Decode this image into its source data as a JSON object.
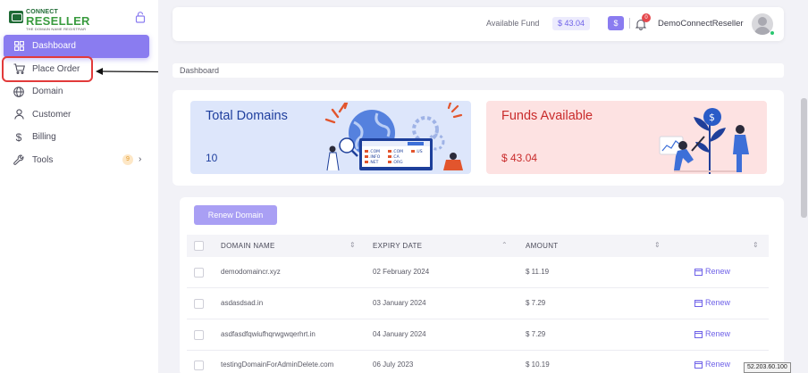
{
  "logo": {
    "top": "CONNECT",
    "main": "RESELLER",
    "tagline": "THE DOMAIN NAME REGISTRAR"
  },
  "sidebar": {
    "items": [
      {
        "label": "Dashboard",
        "icon": "grid-icon",
        "active": true
      },
      {
        "label": "Place Order",
        "icon": "cart-icon",
        "highlighted": true
      },
      {
        "label": "Domain",
        "icon": "globe-icon"
      },
      {
        "label": "Customer",
        "icon": "user-icon"
      },
      {
        "label": "Billing",
        "icon": "dollar-icon"
      },
      {
        "label": "Tools",
        "icon": "wrench-icon",
        "badge": "9"
      }
    ]
  },
  "header": {
    "fund_label": "Available Fund",
    "fund_value": "$ 43.04",
    "dollar_button": "$",
    "notification_count": "0",
    "username": "DemoConnectReseller"
  },
  "breadcrumb": "Dashboard",
  "stats": {
    "domains": {
      "title": "Total Domains",
      "value": "10",
      "tlds": [
        ".COM",
        ".COM",
        ".US",
        ".INFO",
        ".CA",
        ".NET",
        ".ORG"
      ]
    },
    "funds": {
      "title": "Funds Available",
      "value": "$ 43.04"
    }
  },
  "table": {
    "renew_button": "Renew Domain",
    "columns": [
      "DOMAIN NAME",
      "EXPIRY DATE",
      "AMOUNT"
    ],
    "rows": [
      {
        "domain": "demodomaincr.xyz",
        "expiry": "02 February 2024",
        "amount": "$ 11.19",
        "action": "Renew"
      },
      {
        "domain": "asdasdsad.in",
        "expiry": "03 January 2024",
        "amount": "$ 7.29",
        "action": "Renew"
      },
      {
        "domain": "asdfasdfqwiufhqrwgwqerhrt.in",
        "expiry": "04 January 2024",
        "amount": "$ 7.29",
        "action": "Renew"
      },
      {
        "domain": "testingDomainForAdminDelete.com",
        "expiry": "06 July 2023",
        "amount": "$ 10.19",
        "action": "Renew"
      }
    ]
  },
  "ip_tooltip": "52.203.60.100",
  "colors": {
    "accent": "#8a7cf0",
    "highlight": "#e23a3a",
    "domains_card": "#dde6fb",
    "funds_card": "#fde2e2"
  }
}
